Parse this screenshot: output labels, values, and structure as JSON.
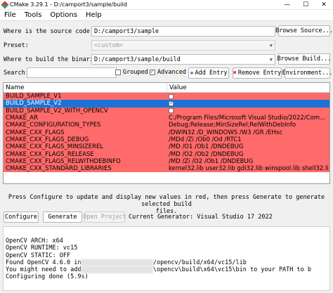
{
  "window": {
    "title": "CMake 3.29.1 - D:/camport3/sample/build",
    "minimize": "—",
    "maximize": "☐",
    "close": "✕"
  },
  "menu": [
    "File",
    "Tools",
    "Options",
    "Help"
  ],
  "source": {
    "label": "Where is the source code:",
    "value": "D:/camport3/sample",
    "browse": "Browse Source..."
  },
  "preset": {
    "label": "Preset:",
    "value": "<custom>"
  },
  "build": {
    "label": "Where to build the binaries:",
    "value": "D:/camport3/sample/build",
    "browse": "Browse Build..."
  },
  "toolbar": {
    "search_label": "Search:",
    "search_value": "",
    "grouped": {
      "label": "Grouped",
      "checked": false
    },
    "advanced": {
      "label": "Advanced",
      "checked": true
    },
    "add_entry": "Add Entry",
    "remove_entry": "Remove Entry",
    "environment": "Environment..."
  },
  "table": {
    "headers": [
      "Name",
      "Value"
    ],
    "rows": [
      {
        "name": "BUILD_SAMPLE_V1",
        "value": "",
        "checkbox": true,
        "checked": false,
        "selected": false
      },
      {
        "name": "BUILD_SAMPLE_V2",
        "value": "",
        "checkbox": true,
        "checked": true,
        "selected": true
      },
      {
        "name": "BUILD_SAMPLE_V2_WITH_OPENCV",
        "value": "",
        "checkbox": true,
        "checked": false,
        "selected": false
      },
      {
        "name": "CMAKE_AR",
        "value": "C:/Program Files/Microsoft Visual Studio/2022/Com...",
        "checkbox": false
      },
      {
        "name": "CMAKE_CONFIGURATION_TYPES",
        "value": "Debug;Release;MinSizeRel;RelWithDebInfo",
        "checkbox": false
      },
      {
        "name": "CMAKE_CXX_FLAGS",
        "value": "/DWIN32 /D_WINDOWS /W3 /GR /EHsc",
        "checkbox": false
      },
      {
        "name": "CMAKE_CXX_FLAGS_DEBUG",
        "value": "/MDd /Zi /Ob0 /Od /RTC1",
        "checkbox": false
      },
      {
        "name": "CMAKE_CXX_FLAGS_MINSIZEREL",
        "value": "/MD /O1 /Ob1 /DNDEBUG",
        "checkbox": false
      },
      {
        "name": "CMAKE_CXX_FLAGS_RELEASE",
        "value": "/MD /O2 /Ob2 /DNDEBUG",
        "checkbox": false
      },
      {
        "name": "CMAKE_CXX_FLAGS_RELWITHDEBINFO",
        "value": "/MD /Zi /O2 /Ob1 /DNDEBUG",
        "checkbox": false
      },
      {
        "name": "CMAKE_CXX_STANDARD_LIBRARIES",
        "value": "kernel32.lib user32.lib gdi32.lib winspool.lib shell32.li",
        "checkbox": false
      }
    ]
  },
  "hint_line1": "Press Configure to update and display new values in red, then press Generate to generate selected build",
  "hint_line2": "files.",
  "actions": {
    "configure": "Configure",
    "generate": "Generate",
    "open_project": "Open Project",
    "generator": "Current Generator: Visual Studio 17 2022"
  },
  "log": [
    "OpenCV ARCH: x64",
    "OpenCV RUNTIME: vc15",
    "OpenCV STATIC: OFF",
    "Found OpenCV 4.6.0 in",
    "You might need to add",
    "Configuring done (5.9s)"
  ],
  "log_tail": [
    "",
    "",
    "",
    "/opencv/build/x64/vc15/lib",
    "\\opencv\\build\\x64\\vc15\\bin to your PATH to b",
    ""
  ],
  "colors": {
    "changed_row": "#ff6a6a",
    "selection": "#1a73d9"
  },
  "icons": {
    "add": "plus-icon",
    "remove": "remove-icon"
  }
}
